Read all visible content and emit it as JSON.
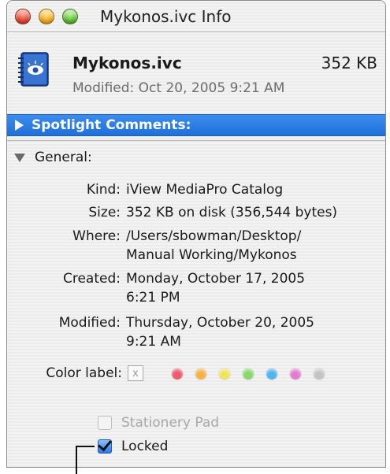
{
  "window": {
    "title": "Mykonos.ivc Info"
  },
  "file": {
    "icon": "catalog-book-icon",
    "name": "Mykonos.ivc",
    "size": "352 KB",
    "modified": "Modified: Oct 20, 2005 9:21 AM"
  },
  "sections": {
    "spotlight_label": "Spotlight Comments:",
    "general_label": "General:"
  },
  "info": {
    "kind_label": "Kind:",
    "kind_value": "iView MediaPro Catalog",
    "size_label": "Size:",
    "size_value": "352 KB on disk (356,544 bytes)",
    "where_label": "Where:",
    "where_value_1": "/Users/sbowman/Desktop/",
    "where_value_2": "Manual Working/Mykonos",
    "created_label": "Created:",
    "created_value_1": "Monday, October 17, 2005",
    "created_value_2": "6:21 PM",
    "modified_label": "Modified:",
    "modified_value_1": "Thursday, October 20, 2005",
    "modified_value_2": "9:21 AM"
  },
  "color_label": {
    "label": "Color label:",
    "none_glyph": "x",
    "colors": [
      "#ef5a6c",
      "#f5b147",
      "#f3e35a",
      "#86d86a",
      "#4fb3ec",
      "#e27bd0",
      "#c4c4c4"
    ]
  },
  "checkboxes": {
    "stationery_label": "Stationery Pad",
    "stationery_checked": false,
    "locked_label": "Locked",
    "locked_checked": true
  }
}
